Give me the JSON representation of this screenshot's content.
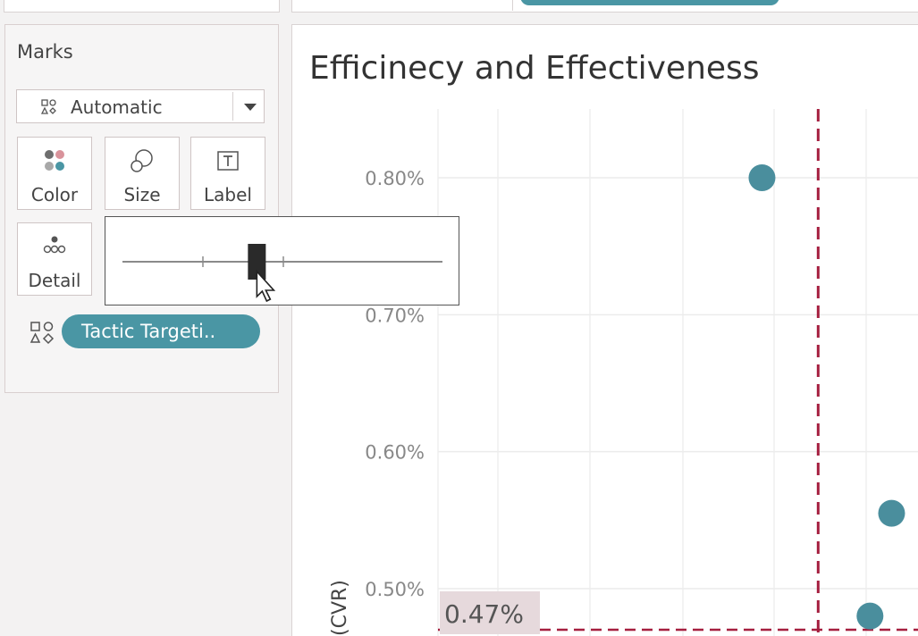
{
  "marks": {
    "title": "Marks",
    "mark_type": {
      "selected": "Automatic"
    },
    "buttons": {
      "color": "Color",
      "size": "Size",
      "label": "Label",
      "detail": "Detail"
    },
    "detail_field_pill": "Tactic Targeti.."
  },
  "size_slider": {
    "value": 0.42
  },
  "chart_data": {
    "type": "scatter",
    "title": "Efficinecy and Effectiveness",
    "ylabel": "(CVR)",
    "y_ticks": [
      "0.80%",
      "0.70%",
      "0.60%",
      "0.50%"
    ],
    "y_tick_values": [
      0.008,
      0.007,
      0.006,
      0.005
    ],
    "ylim_visible": [
      0.0046,
      0.0085
    ],
    "points": [
      {
        "x_relative": 0.75,
        "y": 0.008
      },
      {
        "x_relative": 1.05,
        "y": 0.00555
      },
      {
        "x_relative": 1.0,
        "y": 0.0048
      }
    ],
    "reference_lines": {
      "horizontal": {
        "value": 0.0047,
        "label": "0.47%"
      },
      "vertical": {
        "x_relative": 0.88
      }
    },
    "grid": true,
    "colors": {
      "point": "#4a8e9d",
      "reference": "#a51f3f",
      "label_bg": "#e6d9dc"
    }
  }
}
